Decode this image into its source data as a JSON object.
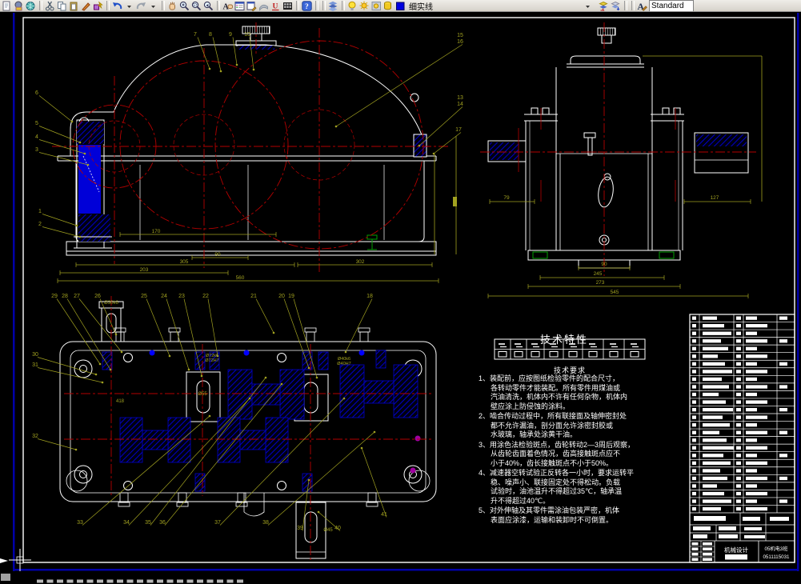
{
  "toolbar": {
    "layer_name": "细实线",
    "style_name": "Standard",
    "groups": [
      {
        "name": "file",
        "icons": [
          "doc",
          "stamp",
          "globe"
        ]
      },
      {
        "name": "clipboard",
        "icons": [
          "cut",
          "copy",
          "paste",
          "brush",
          "fmt"
        ]
      },
      {
        "name": "undo-redo",
        "icons": [
          "undo",
          "chev",
          "redo",
          "chev"
        ]
      },
      {
        "name": "view",
        "icons": [
          "pan",
          "zoomrt",
          "zoomwin",
          "zoomprev"
        ]
      },
      {
        "name": "dialogs",
        "icons": [
          "find",
          "layerdlg",
          "props",
          "render",
          "redu",
          "palette"
        ]
      },
      {
        "name": "help",
        "icons": [
          "help"
        ]
      },
      {
        "name": "layers",
        "icons": [
          "layers"
        ]
      },
      {
        "name": "layer-state",
        "icons": [
          "bulb",
          "sun",
          "locksun",
          "cyl",
          "sq"
        ]
      },
      {
        "name": "layer-tools",
        "icons": [
          "layprev",
          "laystate"
        ]
      },
      {
        "name": "text-style",
        "icons": [
          "atext"
        ]
      }
    ]
  },
  "colors": {
    "line": "#ffffff",
    "center": "#b40000",
    "hatch": "#0000e0",
    "label": "#a2a220",
    "green": "#00a000",
    "border": "#0000a8"
  },
  "front_view": {
    "labels": [
      [
        "7",
        244,
        45,
        262,
        86
      ],
      [
        "8",
        263,
        45,
        276,
        89
      ],
      [
        "9",
        288,
        45,
        296,
        81
      ],
      [
        "10",
        309,
        45,
        317,
        87
      ],
      [
        "6",
        46,
        118,
        90,
        152
      ],
      [
        "5",
        46,
        156,
        100,
        178
      ],
      [
        "4",
        46,
        173,
        106,
        192
      ],
      [
        "3",
        46,
        189,
        110,
        206
      ],
      [
        "1",
        50,
        266,
        96,
        282
      ],
      [
        "2",
        50,
        282,
        100,
        296
      ],
      [
        "15",
        575,
        46,
        0,
        0
      ],
      [
        "16",
        575,
        54,
        420,
        158
      ],
      [
        "13",
        575,
        124,
        0,
        0
      ],
      [
        "14",
        575,
        132,
        524,
        182
      ],
      [
        "17",
        573,
        164,
        542,
        192
      ]
    ],
    "dims": [
      [
        "170",
        195,
        291,
        150,
        345,
        293
      ],
      [
        "90",
        272,
        320,
        240,
        310,
        322
      ],
      [
        "305",
        230,
        329,
        95,
        368,
        331
      ],
      [
        "302",
        450,
        329,
        372,
        540,
        331
      ],
      [
        "203",
        180,
        339,
        75,
        285,
        341
      ],
      [
        "560",
        300,
        349,
        72,
        548,
        351
      ]
    ]
  },
  "side_view": {
    "dims": [
      [
        "79",
        633,
        249,
        612,
        668,
        252
      ],
      [
        "127",
        893,
        249,
        855,
        938,
        252
      ],
      [
        "90",
        755,
        332,
        723,
        787,
        335
      ],
      [
        "245",
        747,
        344,
        675,
        830,
        347
      ],
      [
        "273",
        750,
        355,
        660,
        850,
        358
      ],
      [
        "545",
        768,
        367,
        610,
        935,
        370
      ]
    ]
  },
  "top_view": {
    "labels": [
      [
        "29",
        68,
        372,
        125,
        455
      ],
      [
        "28",
        81,
        372,
        138,
        462
      ],
      [
        "27",
        96,
        372,
        152,
        440
      ],
      [
        "26",
        122,
        372,
        145,
        418
      ],
      [
        "25",
        180,
        372,
        212,
        445
      ],
      [
        "24",
        205,
        372,
        236,
        462
      ],
      [
        "23",
        227,
        372,
        252,
        470
      ],
      [
        "22",
        257,
        372,
        272,
        445
      ],
      [
        "21",
        317,
        372,
        342,
        416
      ],
      [
        "20",
        352,
        372,
        386,
        460
      ],
      [
        "19",
        364,
        372,
        396,
        472
      ],
      [
        "18",
        462,
        372,
        432,
        440
      ],
      [
        "30",
        44,
        445,
        120,
        468
      ],
      [
        "31",
        44,
        458,
        128,
        478
      ],
      [
        "32",
        44,
        547,
        95,
        562
      ],
      [
        "33",
        100,
        655,
        262,
        520
      ],
      [
        "34",
        158,
        655,
        312,
        498
      ],
      [
        "35",
        185,
        655,
        332,
        472
      ],
      [
        "36",
        203,
        655,
        352,
        480
      ],
      [
        "37",
        272,
        655,
        430,
        498
      ],
      [
        "38",
        332,
        655,
        468,
        540
      ],
      [
        "39",
        375,
        662,
        386,
        600
      ],
      [
        "40",
        422,
        662,
        398,
        640
      ],
      [
        "41",
        480,
        645,
        452,
        560
      ]
    ],
    "fit_stacks": [
      [
        "Ø72k6",
        "Ø72H7",
        265,
        446
      ],
      [
        "Ø40k6",
        "Ø40H7",
        430,
        450
      ]
    ],
    "texts": [
      [
        "Ø55",
        253,
        494
      ],
      [
        "418",
        150,
        503
      ],
      [
        "Ø30k6",
        139,
        380
      ],
      [
        "Ø45",
        410,
        664
      ]
    ]
  },
  "notes": {
    "title": "技术特性",
    "subtitle": "技术要求",
    "items": [
      "1、装配前，应按图纸检验零件的配合尺寸，\n      各转动零件才能装配。所有零件用煤油或\n      汽油清洗，机体内不许有任何杂物，机体内\n      壁应涂上防侵蚀的涂料。",
      "2、啮合传动过程中，所有联接面及轴伸密封处\n      都不允许漏油，剖分面允许涂密封胶或\n      水玻璃，轴承处涂黄干油。",
      "3、用涂色法检验斑点，齿轮转动2—3周后观察，\n      从齿轮齿面着色情况，齿高接触斑点应不\n      小于40%，齿长接触斑点不小于50%。",
      "4、减速器空转试验正反转各一小时，要求运转平\n      稳、噪声小、联接固定处不得松动。负载\n      试验时，油池温升不得超过35℃，轴承温\n      升不得超过40℃。",
      "5、对外伸轴及其零件需涂油包装严密，机体\n      表面应涂漆，运输和装卸时不可倒置。"
    ]
  },
  "tech_table": {
    "columns": 8,
    "rows": 2
  },
  "title_block": {
    "parts_rows": 26,
    "course": "机械设计",
    "class_name": "05机电3班",
    "student_no": "0511115031"
  }
}
